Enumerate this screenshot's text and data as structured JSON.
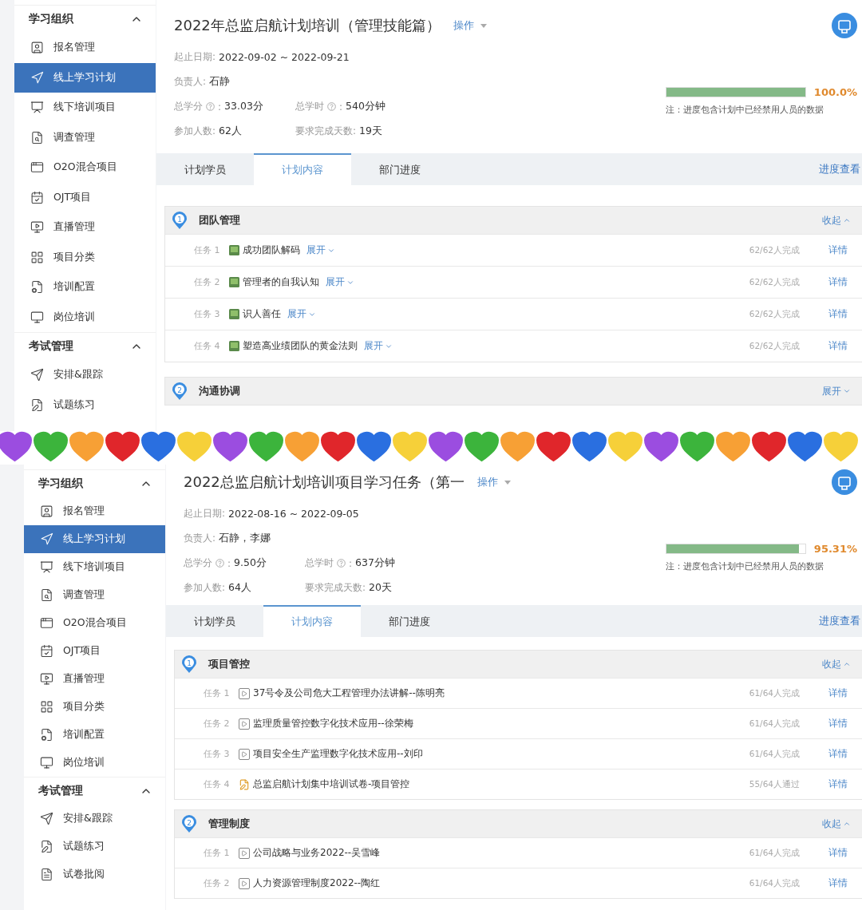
{
  "screens": [
    {
      "sidebar": [
        {
          "title": "学习组织",
          "expanded": true,
          "items": [
            {
              "label": "报名管理",
              "selected": false
            },
            {
              "label": "线上学习计划",
              "selected": true
            },
            {
              "label": "线下培训项目",
              "selected": false
            },
            {
              "label": "调查管理",
              "selected": false
            },
            {
              "label": "O2O混合项目",
              "selected": false
            },
            {
              "label": "OJT项目",
              "selected": false
            },
            {
              "label": "直播管理",
              "selected": false
            },
            {
              "label": "项目分类",
              "selected": false
            },
            {
              "label": "培训配置",
              "selected": false
            },
            {
              "label": "岗位培训",
              "selected": false
            }
          ]
        },
        {
          "title": "考试管理",
          "expanded": true,
          "items": [
            {
              "label": "安排&跟踪",
              "selected": false
            },
            {
              "label": "试题练习",
              "selected": false
            }
          ]
        }
      ],
      "title": "2022年总监启航计划培训（管理技能篇）",
      "action": "操作",
      "fields": [
        [
          {
            "label": "起止日期:",
            "value": "2022-09-02 ~ 2022-09-21"
          }
        ],
        [
          {
            "label": "负责人:",
            "value": "石静"
          }
        ],
        [
          {
            "label": "总学分",
            "help": true,
            "colon": ":",
            "value": "33.03分"
          },
          {
            "label": "总学时",
            "help": true,
            "colon": ":",
            "value": "540分钟"
          }
        ],
        [
          {
            "label": "参加人数:",
            "value": "62人"
          },
          {
            "label": "要求完成天数:",
            "value": "19天"
          }
        ]
      ],
      "progress": {
        "level": 1,
        "reading": "100.0%",
        "note": "注：进度包含计划中已经禁用人员的数据"
      },
      "tabs": [
        {
          "label": "计划学员",
          "selected": false
        },
        {
          "label": "计划内容",
          "selected": true
        },
        {
          "label": "部门进度",
          "selected": false
        }
      ],
      "tab_link": "进度查看",
      "sections": [
        {
          "number": "1",
          "title": "团队管理",
          "toggle": "收起",
          "expanded": true,
          "tasks": [
            {
              "index": "任务 1",
              "kind": "course",
              "name": "成功团队解码",
              "expand": "展开",
              "status": "62/62人完成",
              "detail": "详情"
            },
            {
              "index": "任务 2",
              "kind": "course",
              "name": "管理者的自我认知",
              "expand": "展开",
              "status": "62/62人完成",
              "detail": "详情"
            },
            {
              "index": "任务 3",
              "kind": "course",
              "name": "识人善任",
              "expand": "展开",
              "status": "62/62人完成",
              "detail": "详情"
            },
            {
              "index": "任务 4",
              "kind": "course",
              "name": "塑造高业绩团队的黄金法则",
              "expand": "展开",
              "status": "62/62人完成",
              "detail": "详情"
            }
          ]
        },
        {
          "number": "2",
          "title": "沟通协调",
          "toggle": "展开",
          "expanded": false
        }
      ]
    },
    {
      "sidebar": [
        {
          "title": "学习组织",
          "expanded": true,
          "items": [
            {
              "label": "报名管理",
              "selected": false
            },
            {
              "label": "线上学习计划",
              "selected": true
            },
            {
              "label": "线下培训项目",
              "selected": false
            },
            {
              "label": "调查管理",
              "selected": false
            },
            {
              "label": "O2O混合项目",
              "selected": false
            },
            {
              "label": "OJT项目",
              "selected": false
            },
            {
              "label": "直播管理",
              "selected": false
            },
            {
              "label": "项目分类",
              "selected": false
            },
            {
              "label": "培训配置",
              "selected": false
            },
            {
              "label": "岗位培训",
              "selected": false
            }
          ]
        },
        {
          "title": "考试管理",
          "expanded": true,
          "items": [
            {
              "label": "安排&跟踪",
              "selected": false
            },
            {
              "label": "试题练习",
              "selected": false
            },
            {
              "label": "试卷批阅",
              "selected": false
            }
          ]
        }
      ],
      "title": "2022总监启航计划培训项目学习任务（第一",
      "action": "操作",
      "fields": [
        [
          {
            "label": "起止日期:",
            "value": "2022-08-16 ~ 2022-09-05"
          }
        ],
        [
          {
            "label": "负责人:",
            "value": "石静，李娜"
          }
        ],
        [
          {
            "label": "总学分",
            "help": true,
            "colon": ":",
            "value": "9.50分"
          },
          {
            "label": "总学时",
            "help": true,
            "colon": ":",
            "value": "637分钟"
          }
        ],
        [
          {
            "label": "参加人数:",
            "value": "64人"
          },
          {
            "label": "要求完成天数:",
            "value": "20天"
          }
        ]
      ],
      "progress": {
        "level": 0.9531,
        "reading": "95.31%",
        "note": "注：进度包含计划中已经禁用人员的数据"
      },
      "tabs": [
        {
          "label": "计划学员",
          "selected": false
        },
        {
          "label": "计划内容",
          "selected": true
        },
        {
          "label": "部门进度",
          "selected": false
        }
      ],
      "tab_link": "进度查看",
      "sections": [
        {
          "number": "1",
          "title": "项目管控",
          "toggle": "收起",
          "expanded": true,
          "tasks": [
            {
              "index": "任务 1",
              "kind": "video",
              "name": "37号令及公司危大工程管理办法讲解--陈明亮",
              "status": "61/64人完成",
              "detail": "详情"
            },
            {
              "index": "任务 2",
              "kind": "video",
              "name": "监理质量管控数字化技术应用--徐荣梅",
              "status": "61/64人完成",
              "detail": "详情"
            },
            {
              "index": "任务 3",
              "kind": "video",
              "name": "项目安全生产监理数字化技术应用--刘印",
              "status": "61/64人完成",
              "detail": "详情"
            },
            {
              "index": "任务 4",
              "kind": "exam",
              "name": "总监启航计划集中培训试卷-项目管控",
              "status": "55/64人通过",
              "detail": "详情"
            }
          ]
        },
        {
          "number": "2",
          "title": "管理制度",
          "toggle": "收起",
          "expanded": true,
          "tasks": [
            {
              "index": "任务 1",
              "kind": "video",
              "name": "公司战略与业务2022--吴雪峰",
              "status": "61/64人完成",
              "detail": "详情"
            },
            {
              "index": "任务 2",
              "kind": "video",
              "name": "人力资源管理制度2022--陶红",
              "status": "61/64人完成",
              "detail": "详情"
            }
          ]
        }
      ]
    }
  ],
  "hearts": [
    {
      "color": "#9b4de0"
    },
    {
      "color": "#3cb43c"
    },
    {
      "color": "#f7a035"
    },
    {
      "color": "#e0262b"
    },
    {
      "color": "#2a6fe0"
    },
    {
      "color": "#f6d039"
    },
    {
      "color": "#9b4de0"
    },
    {
      "color": "#3cb43c"
    },
    {
      "color": "#f7a035"
    },
    {
      "color": "#e0262b"
    },
    {
      "color": "#2a6fe0"
    },
    {
      "color": "#f6d039"
    },
    {
      "color": "#9b4de0"
    },
    {
      "color": "#3cb43c"
    },
    {
      "color": "#f7a035"
    },
    {
      "color": "#e0262b"
    },
    {
      "color": "#2a6fe0"
    },
    {
      "color": "#f6d039"
    },
    {
      "color": "#9b4de0"
    },
    {
      "color": "#3cb43c"
    },
    {
      "color": "#f7a035"
    },
    {
      "color": "#e0262b"
    },
    {
      "color": "#2a6fe0"
    },
    {
      "color": "#f6d039"
    }
  ]
}
